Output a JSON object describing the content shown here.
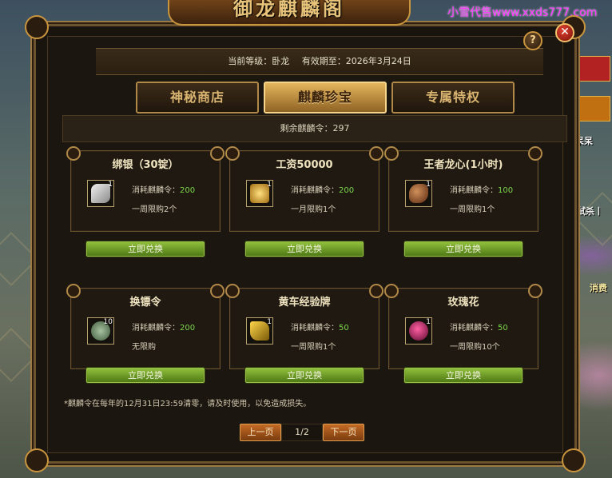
{
  "watermark": "小雪代售www.xxds777.com",
  "window": {
    "title": "御龙麒麟阁",
    "current_level_label": "当前等级：卧龙",
    "valid_until_label": "有效期至：2026年3月24日"
  },
  "tabs": [
    {
      "label": "神秘商店",
      "active": false
    },
    {
      "label": "麒麟珍宝",
      "active": true
    },
    {
      "label": "专属特权",
      "active": false
    }
  ],
  "remaining": "剩余麒麟令：297",
  "cost_prefix": "消耗麒麟令：",
  "items": [
    {
      "name": "绑银（30锭）",
      "cost": "200",
      "limit": "一周限购2个",
      "qty": "1",
      "icon": "silver-ingot-icon",
      "icon_color": "#c9c9c9"
    },
    {
      "name": "工资50000",
      "cost": "200",
      "limit": "一月限购1个",
      "qty": "1",
      "icon": "gold-coin-pile-icon",
      "icon_color": "#e2b23a"
    },
    {
      "name": "王者龙心(1小时)",
      "cost": "100",
      "limit": "一周限购1个",
      "qty": "1",
      "icon": "dragon-head-icon",
      "icon_color": "#b07040"
    },
    {
      "name": "换镖令",
      "cost": "200",
      "limit": "无限购",
      "qty": "10",
      "icon": "jade-token-icon",
      "icon_color": "#7f9a7a"
    },
    {
      "name": "黄车经验牌",
      "cost": "50",
      "limit": "一周限购1个",
      "qty": "1",
      "icon": "yellow-cart-icon",
      "icon_color": "#d4a017"
    },
    {
      "name": "玫瑰花",
      "cost": "50",
      "limit": "一周限购10个",
      "qty": "1",
      "icon": "rose-icon",
      "icon_color": "#c0205a"
    }
  ],
  "redeem_label": "立即兑换",
  "notice": "*麒麟令在每年的12月31日23:59清零，请及时使用，以免造成损失。",
  "pager": {
    "prev": "上一页",
    "current": "1/2",
    "next": "下一页"
  },
  "background_text": {
    "line1": "呆呆",
    "line2": "弑杀丨",
    "line3": "消费"
  }
}
